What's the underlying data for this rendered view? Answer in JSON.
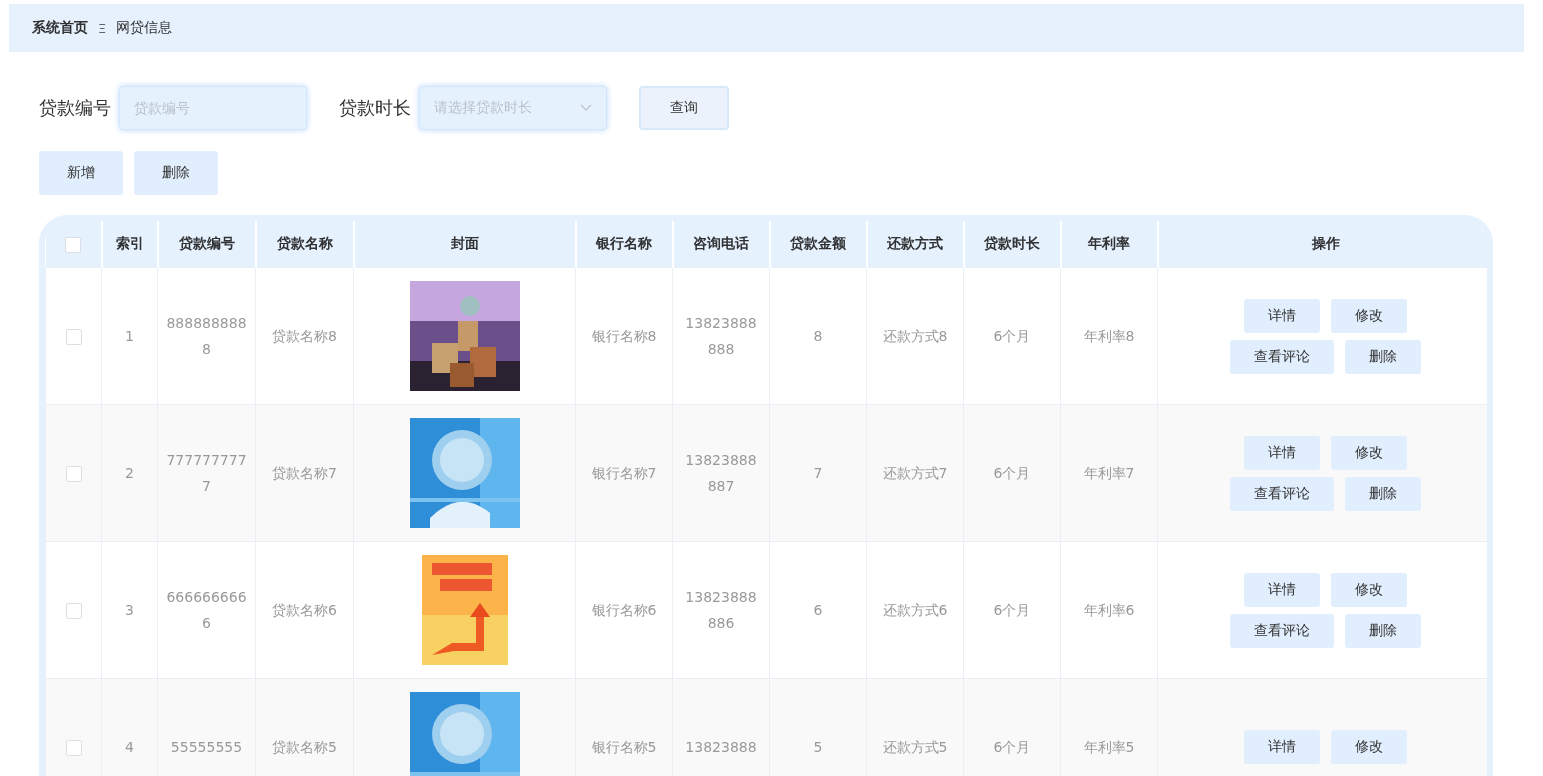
{
  "breadcrumb": {
    "items": [
      "系统首页",
      "网贷信息"
    ],
    "separator": "Ξ"
  },
  "search": {
    "fields": [
      {
        "label": "贷款编号",
        "kind": "input",
        "placeholder": "贷款编号"
      },
      {
        "label": "贷款时长",
        "kind": "select",
        "placeholder": "请选择贷款时长"
      }
    ],
    "button": "查询"
  },
  "toolbar": [
    "新增",
    "删除"
  ],
  "table": {
    "select_all": {
      "checked": false
    },
    "columns": [
      "索引",
      "贷款编号",
      "贷款名称",
      "封面",
      "银行名称",
      "咨询电话",
      "贷款金额",
      "还款方式",
      "贷款时长",
      "年利率",
      "操作"
    ],
    "rows": [
      {
        "checked": false,
        "cells": [
          "1",
          "8888888888",
          "贷款名称8",
          {
            "kind": "picture"
          },
          "银行名称8",
          "13823888888",
          "8",
          "还款方式8",
          "6个月",
          "年利率8"
        ],
        "actions": [
          "详情",
          "修改",
          "查看评论",
          "删除"
        ]
      },
      {
        "checked": false,
        "cells": [
          "2",
          "7777777777",
          "贷款名称7",
          {
            "kind": "picture"
          },
          "银行名称7",
          "13823888887",
          "7",
          "还款方式7",
          "6个月",
          "年利率7"
        ],
        "actions": [
          "详情",
          "修改",
          "查看评论",
          "删除"
        ]
      },
      {
        "checked": false,
        "cells": [
          "3",
          "6666666666",
          "贷款名称6",
          {
            "kind": "picture"
          },
          "银行名称6",
          "13823888886",
          "6",
          "还款方式6",
          "6个月",
          "年利率6"
        ],
        "actions": [
          "详情",
          "修改",
          "查看评论",
          "删除"
        ]
      },
      {
        "checked": false,
        "cells": [
          "4",
          "55555555",
          "贷款名称5",
          {
            "kind": "picture"
          },
          "银行名称5",
          "13823888",
          "5",
          "还款方式5",
          "6个月",
          "年利率5"
        ],
        "actions": [
          "详情",
          "修改"
        ]
      }
    ]
  }
}
